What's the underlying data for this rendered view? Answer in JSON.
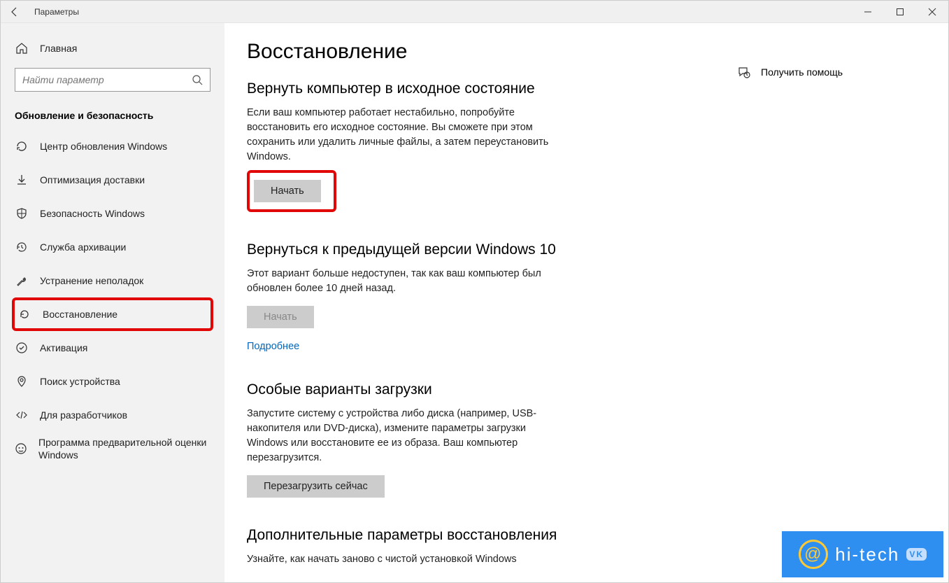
{
  "titlebar": {
    "title": "Параметры"
  },
  "sidebar": {
    "home_label": "Главная",
    "search_placeholder": "Найти параметр",
    "section_title": "Обновление и безопасность",
    "items": [
      {
        "label": "Центр обновления Windows"
      },
      {
        "label": "Оптимизация доставки"
      },
      {
        "label": "Безопасность Windows"
      },
      {
        "label": "Служба архивации"
      },
      {
        "label": "Устранение неполадок"
      },
      {
        "label": "Восстановление"
      },
      {
        "label": "Активация"
      },
      {
        "label": "Поиск устройства"
      },
      {
        "label": "Для разработчиков"
      },
      {
        "label": "Программа предварительной оценки Windows"
      }
    ]
  },
  "main": {
    "page_title": "Восстановление",
    "reset": {
      "heading": "Вернуть компьютер в исходное состояние",
      "body": "Если ваш компьютер работает нестабильно, попробуйте восстановить его исходное состояние. Вы сможете при этом сохранить или удалить личные файлы, а затем переустановить Windows.",
      "button": "Начать"
    },
    "goback": {
      "heading": "Вернуться к предыдущей версии Windows 10",
      "body": "Этот вариант больше недоступен, так как ваш компьютер был обновлен более 10 дней назад.",
      "button": "Начать",
      "link": "Подробнее"
    },
    "advanced_startup": {
      "heading": "Особые варианты загрузки",
      "body": "Запустите систему с устройства либо диска (например, USB-накопителя или DVD-диска), измените параметры загрузки Windows или восстановите ее из образа. Ваш компьютер перезагрузится.",
      "button": "Перезагрузить сейчас"
    },
    "more": {
      "heading": "Дополнительные параметры восстановления",
      "body": "Узнайте, как начать заново с чистой установкой Windows"
    }
  },
  "right": {
    "help_label": "Получить помощь"
  },
  "watermark": {
    "text": "hi-tech",
    "badge": "VK"
  }
}
